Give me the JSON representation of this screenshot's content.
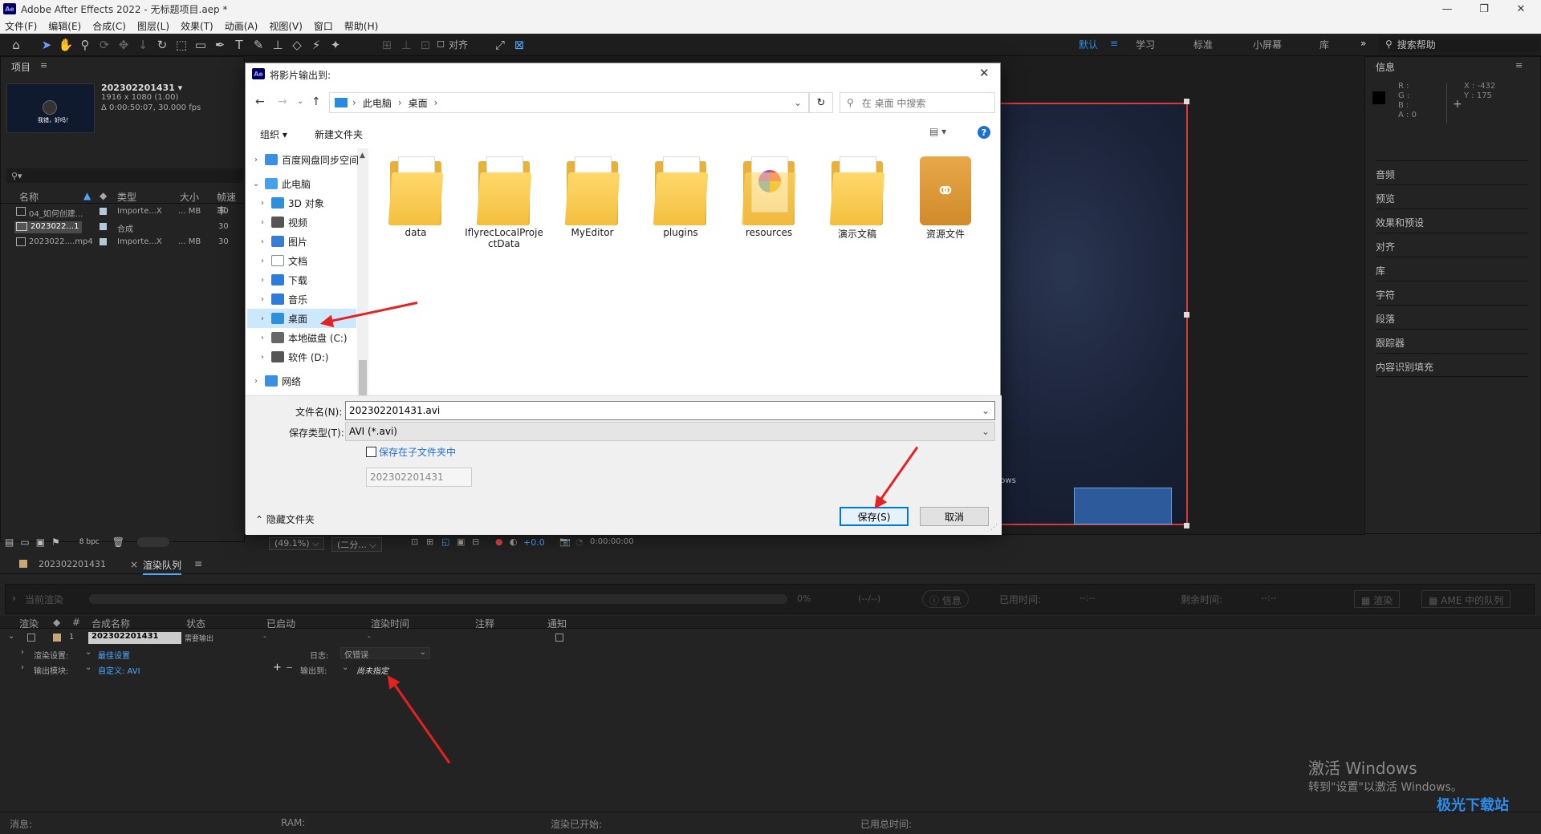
{
  "app": {
    "title": "Adobe After Effects 2022 - 无标题项目.aep *",
    "logo": "Ae"
  },
  "menu": [
    "文件(F)",
    "编辑(E)",
    "合成(C)",
    "图层(L)",
    "效果(T)",
    "动画(A)",
    "视图(V)",
    "窗口",
    "帮助(H)"
  ],
  "toolbar": {
    "snap_label": "对齐"
  },
  "workspaces": [
    "默认",
    "学习",
    "标准",
    "小屏幕",
    "库"
  ],
  "search_help": "搜索帮助",
  "project": {
    "title": "项目",
    "preview": {
      "name": "202302201431 ▾",
      "res": "1916 x 1080 (1.00)",
      "dur": "Δ 0:00:50:07, 30.000 fps",
      "thumb_text": "我错，好吗！"
    },
    "columns": [
      "名称",
      "类型",
      "大小",
      "帧速率"
    ],
    "rows": [
      {
        "name": "04_如何创建...",
        "type": "Importe...X",
        "size": "... MB",
        "fps": "30"
      },
      {
        "name": "2023022...1",
        "type": "合成",
        "size": "",
        "fps": "30"
      },
      {
        "name": "2023022....mp4",
        "type": "Importe...X",
        "size": "... MB",
        "fps": "30"
      }
    ],
    "bpc": "8 bpc"
  },
  "info": {
    "title": "信息",
    "r": "R :",
    "g": "G :",
    "b": "B :",
    "a": "A : 0",
    "x": "X : -432",
    "y": "Y : 175"
  },
  "right_panels": [
    "音频",
    "预览",
    "效果和预设",
    "对齐",
    "库",
    "字符",
    "段落",
    "跟踪器",
    "内容识别填充"
  ],
  "viewer": {
    "zoom": "(49.1%)",
    "res": "(二分...",
    "exposure": "+0.0",
    "timecode": "0:00:00:00",
    "watermark_title": "激活 Windows",
    "watermark_sub": "转到"
  },
  "dialog": {
    "title": "将影片输出到:",
    "breadcrumb": [
      "此电脑",
      "桌面"
    ],
    "search_placeholder": "在 桌面 中搜索",
    "organize": "组织 ▾",
    "new_folder": "新建文件夹",
    "nav": [
      {
        "label": "百度网盘同步空间",
        "indent": 0,
        "color": "#3b8fe0"
      },
      {
        "label": "此电脑",
        "indent": 0,
        "color": "#4aa0e8",
        "expanded": true
      },
      {
        "label": "3D 对象",
        "indent": 1,
        "color": "#2f8fd8"
      },
      {
        "label": "视频",
        "indent": 1,
        "color": "#555"
      },
      {
        "label": "图片",
        "indent": 1,
        "color": "#3a7bd5"
      },
      {
        "label": "文档",
        "indent": 1,
        "color": "#7a8da8"
      },
      {
        "label": "下载",
        "indent": 1,
        "color": "#2f7bd8"
      },
      {
        "label": "音乐",
        "indent": 1,
        "color": "#2f7bd8"
      },
      {
        "label": "桌面",
        "indent": 1,
        "color": "#2f8fd8",
        "selected": true
      },
      {
        "label": "本地磁盘 (C:)",
        "indent": 1,
        "color": "#666"
      },
      {
        "label": "软件 (D:)",
        "indent": 1,
        "color": "#555"
      },
      {
        "label": "网络",
        "indent": 0,
        "color": "#3b8fe0"
      }
    ],
    "folders": [
      {
        "name": "data"
      },
      {
        "name": "IflyrecLocalProjectData"
      },
      {
        "name": "MyEditor"
      },
      {
        "name": "plugins"
      },
      {
        "name": "resources"
      },
      {
        "name": "演示文稿"
      },
      {
        "name": "资源文件"
      }
    ],
    "filename_label": "文件名(N):",
    "filename": "202302201431.avi",
    "filetype_label": "保存类型(T):",
    "filetype": "AVI (*.avi)",
    "subfolder_label": "保存在子文件夹中",
    "subfolder_value": "202302201431",
    "hide_folders": "隐藏文件夹",
    "save": "保存(S)",
    "cancel": "取消"
  },
  "timeline_tabs": [
    {
      "label": "202302201431"
    },
    {
      "label": "渲染队列"
    }
  ],
  "render_bar": {
    "current": "当前渲染",
    "pct": "0%",
    "time": "(--/--)",
    "info": "信息",
    "elapsed": "已用时间:",
    "elapsed_val": "--:--",
    "remaining": "剩余时间:",
    "remaining_val": "--:--",
    "render": "渲染",
    "ame": "AME 中的队列"
  },
  "queue_cols": [
    "渲染",
    "#",
    "合成名称",
    "状态",
    "已启动",
    "渲染时间",
    "注释",
    "通知"
  ],
  "queue_item": {
    "num": "1",
    "comp": "202302201431",
    "status": "需要输出",
    "started": "-",
    "time": "-",
    "render_settings_label": "渲染设置:",
    "render_settings": "最佳设置",
    "log_label": "日志:",
    "log": "仅错误",
    "output_module_label": "输出模块:",
    "output_module": "自定义: AVI",
    "output_to_label": "输出到:",
    "output_to": "尚未指定"
  },
  "status_bar": {
    "msg": "消息:",
    "ram": "RAM:",
    "started": "渲染已开始:",
    "total": "已用总时间:"
  },
  "win_activate": {
    "title": "激活 Windows",
    "sub": "转到\"设置\"以激活 Windows。"
  },
  "corner_watermark": "极光下载站"
}
